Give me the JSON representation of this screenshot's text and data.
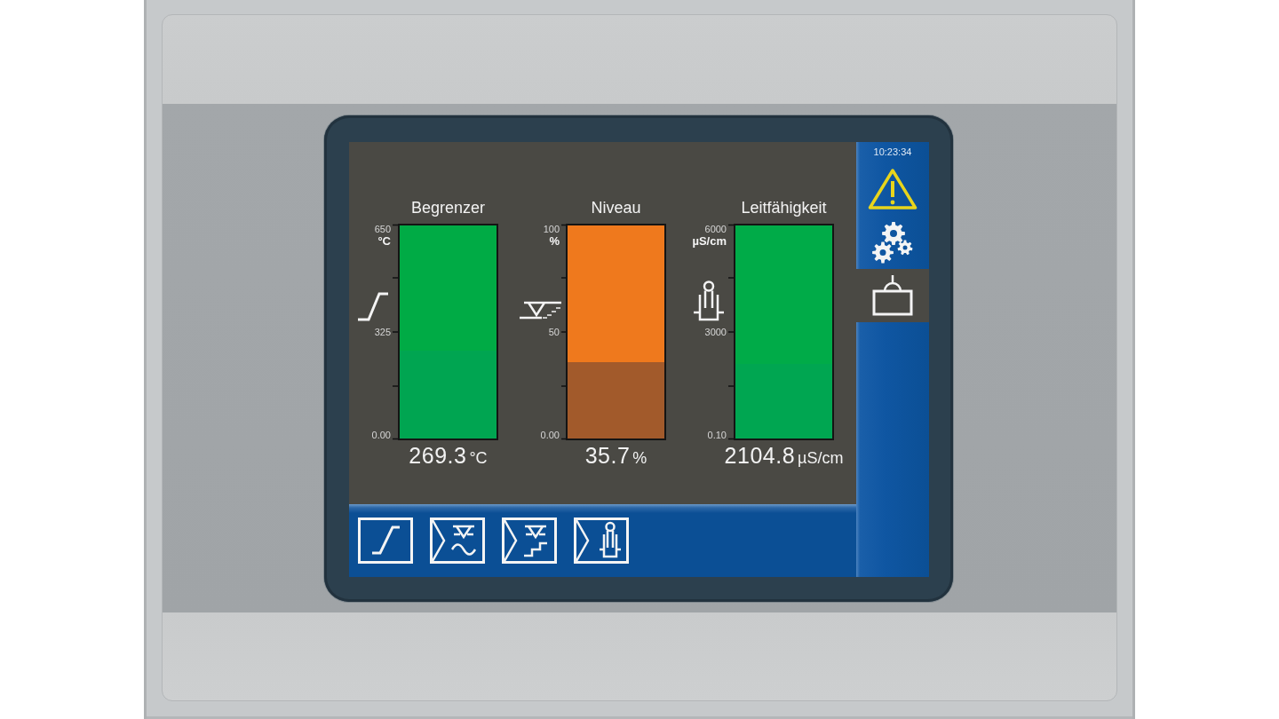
{
  "screen": {
    "meters": [
      {
        "kind": "temperature",
        "title": "Begrenzer",
        "scale_max": "650",
        "scale_unit": "°C",
        "scale_mid": "325",
        "scale_min": "0.00",
        "color": "#00ab45",
        "fill": {
          "color": "#00a551"
        },
        "level": 0.414,
        "value": "269.3",
        "unit": "°C"
      },
      {
        "kind": "level",
        "title": "Niveau",
        "scale_max": "100",
        "scale_unit": "%",
        "scale_mid": "50",
        "scale_min": "0.00",
        "color": "#ef791d",
        "fill": {
          "color": "#a25a2b"
        },
        "level": 0.357,
        "value": "35.7",
        "unit": "%"
      },
      {
        "kind": "conductivity",
        "title": "Leitfähigkeit",
        "scale_max": "6000",
        "scale_unit": "µS/cm",
        "scale_mid": "3000",
        "scale_min": "0.10",
        "color": "#00ab48",
        "fill": {
          "color": "#00a651"
        },
        "level": 0.351,
        "value": "2104.8",
        "unit": "µS/cm"
      }
    ],
    "sidebar": {
      "time": "10:23:34",
      "items": [
        {
          "kind": "warning",
          "selected": false
        },
        {
          "kind": "settings",
          "selected": false
        },
        {
          "kind": "box",
          "selected": true
        }
      ]
    },
    "nav_buttons": [
      {
        "kind": "temperature"
      },
      {
        "kind": "level-wave"
      },
      {
        "kind": "level-steps"
      },
      {
        "kind": "conductivity"
      }
    ]
  }
}
